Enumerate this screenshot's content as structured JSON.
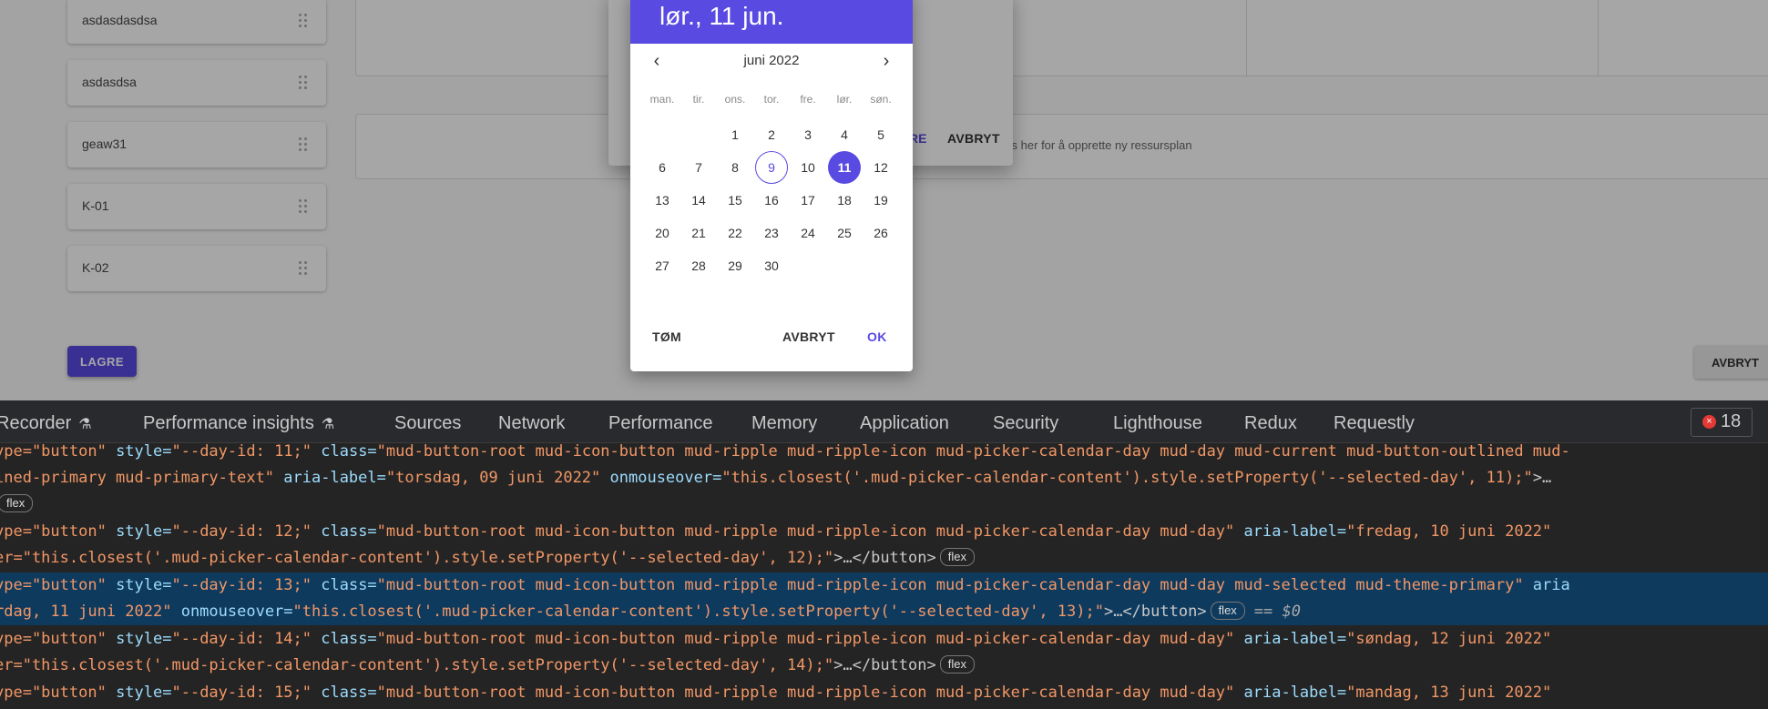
{
  "list_items": [
    "asdasdasdsa",
    "asdasdsa",
    "geaw31",
    "K-01",
    "K-02"
  ],
  "main_hint": "urs her for å opprette ny ressursplan",
  "save_button": "LAGRE",
  "cancel_button_right": "AVBRYT",
  "dialog": {
    "save_fragment": "RE",
    "cancel": "AVBRYT"
  },
  "picker": {
    "header_date": "lør., 11 jun.",
    "month_label": "juni 2022",
    "weekdays": [
      "man.",
      "tir.",
      "ons.",
      "tor.",
      "fre.",
      "lør.",
      "søn."
    ],
    "days": [
      "1",
      "2",
      "3",
      "4",
      "5",
      "6",
      "7",
      "8",
      "9",
      "10",
      "11",
      "12",
      "13",
      "14",
      "15",
      "16",
      "17",
      "18",
      "19",
      "20",
      "21",
      "22",
      "23",
      "24",
      "25",
      "26",
      "27",
      "28",
      "29",
      "30"
    ],
    "current_day": "9",
    "selected_day": "11",
    "clear_label": "TØM",
    "cancel_label": "AVBRYT",
    "ok_label": "OK"
  },
  "devtools": {
    "tabs": [
      "Recorder",
      "Performance insights",
      "Sources",
      "Network",
      "Performance",
      "Memory",
      "Application",
      "Security",
      "Lighthouse",
      "Redux",
      "Requestly"
    ],
    "error_count": "18",
    "lines": [
      {
        "t1": "ype=\"button\" ",
        "a2": "style=",
        "v2": "\"--day-id: 11;\" ",
        "a3": "class=",
        "v3": "\"mud-button-root mud-icon-button mud-ripple mud-ripple-icon mud-picker-calendar-day mud-day mud-current mud-button-outlined mud-"
      },
      {
        "v1": "ined-primary mud-primary-text\" ",
        "a2": "aria-label=",
        "v2": "\"torsdag, 09 juni 2022\" ",
        "a3": "onmouseover=",
        "v3": "\"this.closest('.mud-picker-calendar-content').style.setProperty('--selected-day', 11);\"",
        "p4": ">…"
      },
      {
        "badge": "flex"
      },
      {
        "t1": "ype=\"button\" ",
        "a2": "style=",
        "v2": "\"--day-id: 12;\" ",
        "a3": "class=",
        "v3": "\"mud-button-root mud-icon-button mud-ripple mud-ripple-icon mud-picker-calendar-day mud-day\" ",
        "a4": "aria-label=",
        "v4": "\"fredag, 10 juni 2022\""
      },
      {
        "t1": "er=\"this.closest('.mud-picker-calendar-content').style.setProperty('--selected-day', 12);\"",
        "p2": ">…</button>",
        "badge": "flex"
      },
      {
        "t1": "ype=\"button\" ",
        "a2": "style=",
        "v2": "\"--day-id: 13;\" ",
        "a3": "class=",
        "v3": "\"mud-button-root mud-icon-button mud-ripple mud-ripple-icon mud-picker-calendar-day mud-day mud-selected mud-theme-primary\" ",
        "a4": "aria"
      },
      {
        "v1": "rdag, 11 juni 2022\" ",
        "a2": "onmouseover=",
        "v2": "\"this.closest('.mud-picker-calendar-content').style.setProperty('--selected-day', 13);\"",
        "p3": ">…</button>",
        "badge": "flex",
        "eq": "== $0"
      },
      {
        "t1": "ype=\"button\" ",
        "a2": "style=",
        "v2": "\"--day-id: 14;\" ",
        "a3": "class=",
        "v3": "\"mud-button-root mud-icon-button mud-ripple mud-ripple-icon mud-picker-calendar-day mud-day\" ",
        "a4": "aria-label=",
        "v4": "\"søndag, 12 juni 2022\""
      },
      {
        "t1": "er=\"this.closest('.mud-picker-calendar-content').style.setProperty('--selected-day', 14);\"",
        "p2": ">…</button>",
        "badge": "flex"
      },
      {
        "t1": "ype=\"button\" ",
        "a2": "style=",
        "v2": "\"--day-id: 15;\" ",
        "a3": "class=",
        "v3": "\"mud-button-root mud-icon-button mud-ripple mud-ripple-icon mud-picker-calendar-day mud-day\" ",
        "a4": "aria-label=",
        "v4": "\"mandag, 13 juni 2022\""
      }
    ]
  },
  "colors": {
    "primary": "#594ae2",
    "selected_line": "#0e3a5e"
  }
}
